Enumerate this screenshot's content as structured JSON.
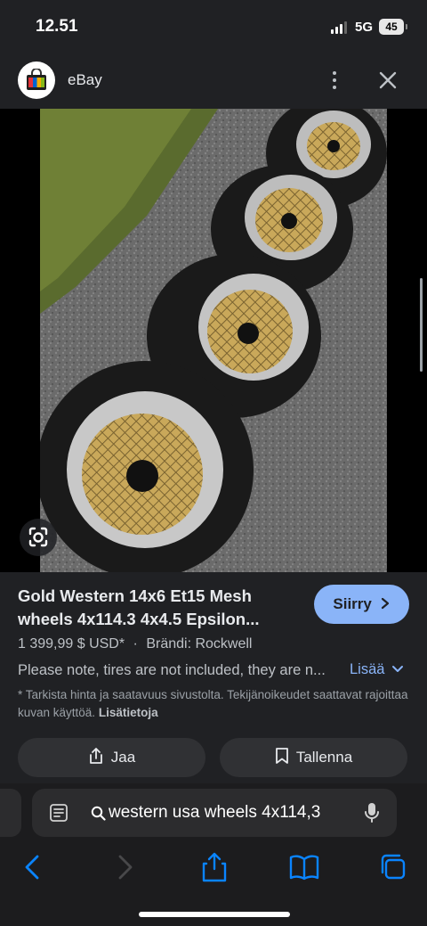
{
  "status_bar": {
    "time": "12.51",
    "network": "5G",
    "battery": "45"
  },
  "header": {
    "site_name": "eBay"
  },
  "product": {
    "title_line1": "Gold Western 14x6 Et15 Mesh",
    "title_line2": "wheels 4x114.3 4x4.5 Epsilon...",
    "visit_label": "Siirry",
    "price": "1 399,99 $ USD*",
    "separator": "·",
    "brand": "Brändi: Rockwell",
    "description": "Please note, tires are not included, they are n...",
    "more_label": "Lisää",
    "disclaimer": "* Tarkista hinta ja saatavuus sivustolta. Tekijänoikeudet saattavat rajoittaa kuvan käyttöä.",
    "disclaimer_link": "Lisätietoja",
    "share_label": "Jaa",
    "save_label": "Tallenna"
  },
  "browser": {
    "address": "western usa wheels 4x114,3"
  },
  "colors": {
    "background": "#202124",
    "accent": "#8ab4f8",
    "button_bg": "#303134",
    "ios_blue": "#0a84ff"
  },
  "icons": {
    "logo": "ebay-shopping-bag-icon",
    "menu": "more-vert-icon",
    "close": "close-icon",
    "lens": "google-lens-icon",
    "visit": "chevron-right-icon",
    "more": "chevron-down-icon",
    "share": "share-icon",
    "save": "bookmark-icon",
    "reader": "reader-mode-icon",
    "search": "search-icon",
    "mic": "microphone-icon",
    "back": "back-arrow-icon",
    "forward": "forward-arrow-icon",
    "tabs": "tabs-icon",
    "bookmarks": "bookmarks-icon"
  }
}
